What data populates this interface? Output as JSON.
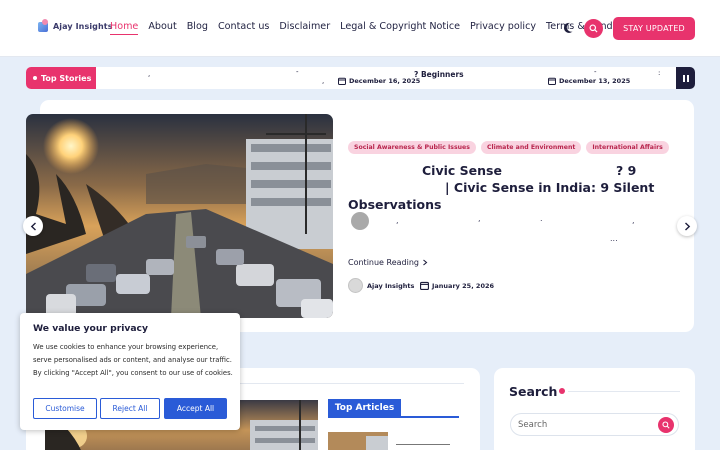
{
  "header": {
    "logo_text": "Ajay Insights",
    "nav": [
      "Home",
      "About",
      "Blog",
      "Contact us",
      "Disclaimer",
      "Legal & Copyright Notice",
      "Privacy policy",
      "Terms & Conditions"
    ],
    "active_nav": "Home",
    "cta_label": "STAY UPDATED",
    "accent_color": "#e8336d"
  },
  "ticker": {
    "label": "Top Stories",
    "item_title": "? Beginners",
    "dates": [
      "December 16, 2025",
      "December 13, 2025"
    ]
  },
  "hero": {
    "tags": [
      "Social Awareness & Public Issues",
      "Climate and Environment",
      "International Affairs"
    ],
    "title_line1": "Civic Sense",
    "title_line1_suffix": "? 9",
    "title_line2": "| Civic Sense in India: 9 Silent",
    "title_line3": "Observations",
    "excerpt_ellipsis": "...",
    "continue_label": "Continue Reading",
    "author": "Ajay Insights",
    "date": "January 25, 2026"
  },
  "lower": {
    "top_articles_label": "Top Articles"
  },
  "sidebar": {
    "search_title": "Search",
    "search_placeholder": "Search"
  },
  "cookie": {
    "title": "We value your privacy",
    "body": "We use cookies to enhance your browsing experience, serve personalised ads or content, and analyse our traffic. By clicking \"Accept All\", you consent to our use of cookies.",
    "customise_label": "Customise",
    "reject_label": "Reject All",
    "accept_label": "Accept All",
    "button_color": "#2a5bd7"
  }
}
